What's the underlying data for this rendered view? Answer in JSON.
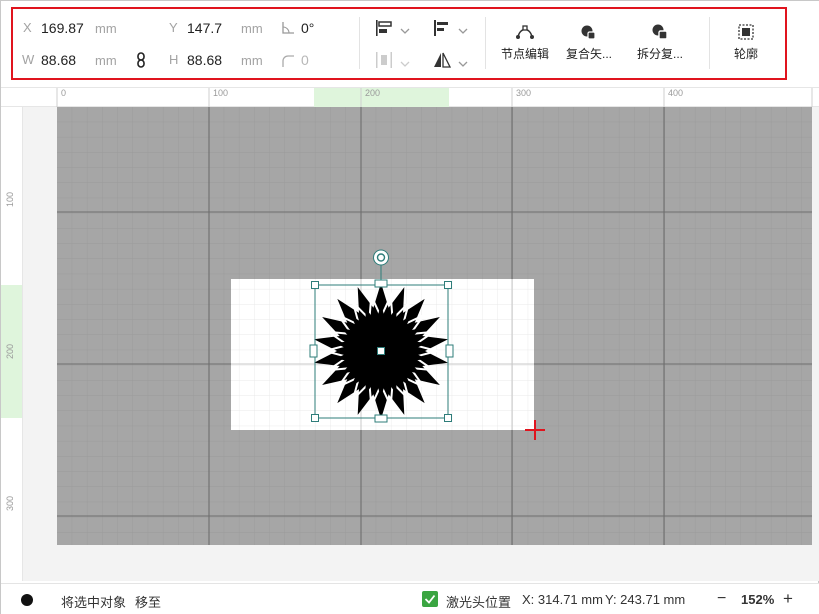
{
  "toolbar": {
    "x": {
      "label": "X",
      "value": "169.87",
      "unit": "mm"
    },
    "y": {
      "label": "Y",
      "value": "147.7",
      "unit": "mm"
    },
    "w": {
      "label": "W",
      "value": "88.68",
      "unit": "mm"
    },
    "h": {
      "label": "H",
      "value": "88.68",
      "unit": "mm"
    },
    "rotation": "0°",
    "corner_radius": "0",
    "buttons": {
      "node_edit": "节点编辑",
      "combine": "复合矢...",
      "split": "拆分复...",
      "outline": "轮廓"
    }
  },
  "ruler": {
    "h_ticks": [
      "0",
      "100",
      "200",
      "300",
      "400"
    ],
    "v_ticks": [
      "100",
      "200",
      "300"
    ]
  },
  "status": {
    "move_label": "将选中对象",
    "move_link": "移至",
    "laser_position": "激光头位置",
    "coord_x": "X: 314.71 mm",
    "coord_y": "Y: 243.71 mm",
    "zoom": "152%"
  },
  "colors": {
    "accent": "#3aa541",
    "highlight_box": "#e0141e",
    "selection": "#2e7d7a",
    "canvas_bg": "#a6a6a6",
    "laser_cross": "#e0141e"
  }
}
